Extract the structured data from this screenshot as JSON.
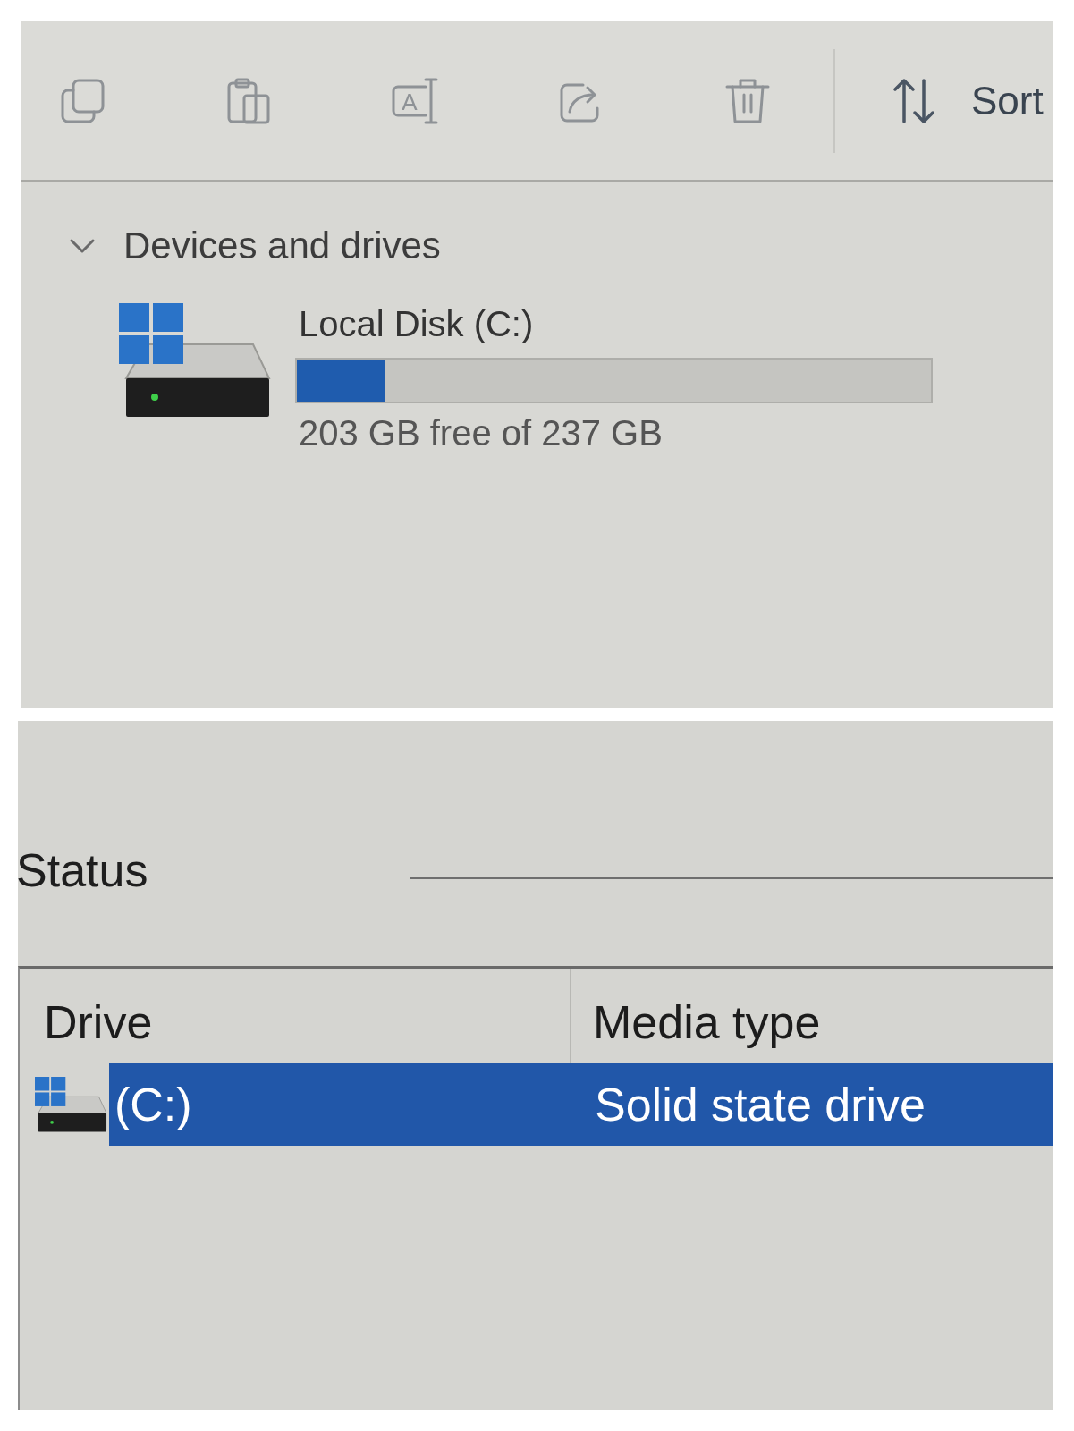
{
  "toolbar": {
    "buttons": [
      {
        "disabled": true
      },
      {
        "disabled": true
      },
      {
        "glyph": "A",
        "disabled": true
      },
      {
        "disabled": true
      },
      {
        "disabled": true
      }
    ],
    "sort": {
      "label": "Sort"
    }
  },
  "devices": {
    "heading": "Devices and drives",
    "expanded": true,
    "drives": [
      {
        "name": "Local Disk (C:)",
        "level": 0.14,
        "space": "203 GB free of 237 GB"
      }
    ]
  },
  "status": {
    "title": "Status",
    "table": {
      "columns": [
        "Drive",
        "Media type"
      ],
      "rows": [
        {
          "drive": "(C:)",
          "media_type": "Solid state drive",
          "selected": true
        }
      ]
    }
  }
}
